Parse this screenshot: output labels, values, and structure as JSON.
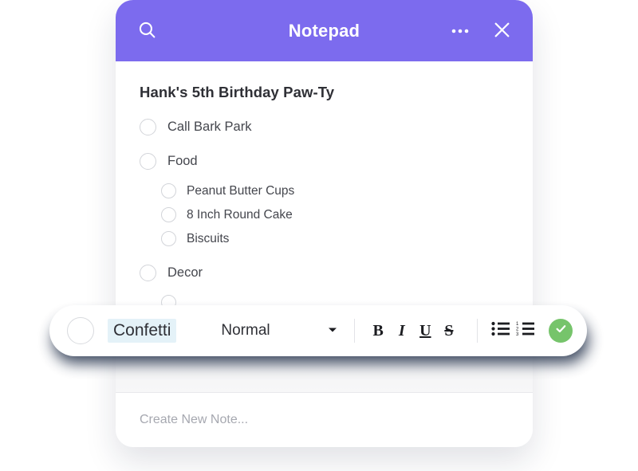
{
  "header": {
    "title": "Notepad",
    "search_icon": "search-icon",
    "overflow_icon": "more-horizontal-icon",
    "close_icon": "close-icon",
    "background_color": "#7c6bee"
  },
  "note": {
    "title": "Hank's 5th Birthday Paw-Ty",
    "items": [
      {
        "label": "Call Bark Park",
        "level": 0,
        "checked": false
      },
      {
        "label": "Food",
        "level": 0,
        "checked": false
      },
      {
        "label": "Peanut Butter Cups",
        "level": 1,
        "checked": false
      },
      {
        "label": "8 Inch Round Cake",
        "level": 1,
        "checked": false
      },
      {
        "label": "Biscuits",
        "level": 1,
        "checked": false
      },
      {
        "label": "Decor",
        "level": 0,
        "checked": false
      }
    ]
  },
  "toolbar": {
    "selected_text": "Confetti",
    "selection_highlight_color": "#e4f2f8",
    "checkbox_icon": "circle-checkbox-icon",
    "style_value": "Normal",
    "style_caret_icon": "chevron-down-icon",
    "bold_label": "B",
    "italic_label": "I",
    "underline_label": "U",
    "strikethrough_label": "S",
    "bullet_list_icon": "bullet-list-icon",
    "numbered_list_icon": "numbered-list-icon",
    "numbered_list_digits": [
      "1",
      "2",
      "3"
    ],
    "confirm_icon": "check-circle-icon",
    "confirm_color": "#76c46b"
  },
  "footer": {
    "create_note_placeholder": "Create New Note..."
  }
}
